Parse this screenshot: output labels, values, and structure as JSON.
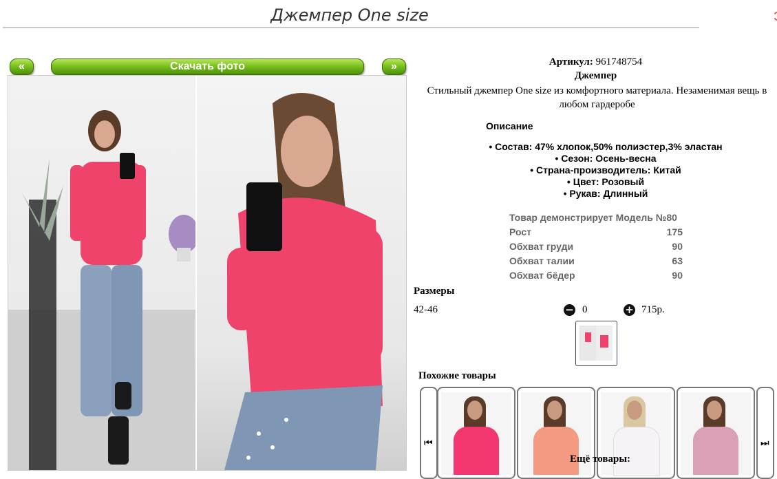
{
  "page": {
    "title": "Джемпер One size",
    "corner_mark": "Э"
  },
  "gallery": {
    "prev_label": "«",
    "download_label": "Скачать фото",
    "next_label": "»"
  },
  "product": {
    "article_label": "Артикул:",
    "article_value": "961748754",
    "name": "Джемпер",
    "description": "Стильный джемпер One size из комфортного материала. Незаменимая вещь в любом гардеробе",
    "description_heading": "Описание",
    "properties": [
      "Состав: 47% хлопок,50% полиэстер,3% эластан",
      "Сезон: Осень-весна",
      "Страна-производитель: Китай",
      "Цвет: Розовый",
      "Рукав: Длинный"
    ],
    "model": {
      "heading": "Товар демонстрирует Модель №80",
      "rows": [
        {
          "label": "Рост",
          "value": "175"
        },
        {
          "label": "Обхват груди",
          "value": "90"
        },
        {
          "label": "Обхват талии",
          "value": "63"
        },
        {
          "label": "Обхват бёдер",
          "value": "90"
        }
      ]
    },
    "sizes_heading": "Размеры",
    "size": "42-46",
    "minus_icon": "minus-circle-icon",
    "plus_icon": "plus-circle-icon",
    "quantity": "0",
    "price": "715р."
  },
  "similar": {
    "heading": "Похожие товары",
    "prev_icon": "skip-back-icon",
    "next_icon": "skip-forward-icon",
    "item_colors": [
      "#f2386f",
      "#f59a82",
      "#f6f2f6",
      "#d9a0b6"
    ]
  },
  "more": {
    "heading": "Ещё товары:"
  },
  "colors": {
    "accent_green": "#6fb51c",
    "sweater_pink": "#f0436b"
  }
}
